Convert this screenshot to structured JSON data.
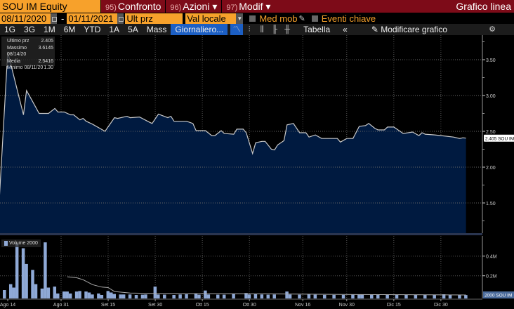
{
  "header": {
    "ticker": "SOU IM Equity",
    "compare": {
      "num": "95)",
      "label": "Confronto"
    },
    "actions": {
      "num": "96)",
      "label": "Azioni ▾"
    },
    "modify": {
      "num": "97)",
      "label": "Modif ▾"
    },
    "chart_type": "Grafico linea"
  },
  "controls": {
    "start_date": "08/11/2020",
    "separator": "-",
    "end_date": "01/11/2021",
    "field": "Ult prz",
    "currency": "Val locale",
    "moving_avg": "Med mob",
    "key_events": "Eventi chiave"
  },
  "toolbar": {
    "ranges": [
      "1G",
      "3G",
      "1M",
      "6M",
      "YTD",
      "1A",
      "5A",
      "Mass"
    ],
    "period": "Giornaliero...",
    "table": "Tabella",
    "collapse": "«",
    "edit": "Modificare grafico"
  },
  "legend": {
    "last_label": "Ultimo prz",
    "last_value": "2.405",
    "high_label": "Massimo 08/14/20",
    "high_value": "3.6145",
    "avg_label": "Media",
    "avg_value": "2.5416",
    "low_label": "Minimo 08/11/20",
    "low_value": "1.30"
  },
  "volume_legend": "Volume 2000",
  "colors": {
    "orange": "#f7a12b",
    "header_red": "#7d0b18",
    "area": "#001a40",
    "line": "#c8c8c8",
    "volume": "#8fa9d6",
    "active": "#1c5fc4"
  },
  "chart_data": {
    "type": "area",
    "x_unit": "days since 08/11/2020",
    "price": {
      "ylim": [
        1.1,
        3.8
      ],
      "ticks": [
        "3.50",
        "3.00",
        "2.50",
        "2.00",
        "1.50"
      ],
      "tick_values": [
        3.5,
        3.0,
        2.5,
        2.0,
        1.5
      ],
      "last_tag": "2.405 SOU IM",
      "points": [
        [
          0,
          1.3
        ],
        [
          3,
          3.61
        ],
        [
          8,
          2.73
        ],
        [
          9,
          3.07
        ],
        [
          11,
          2.91
        ],
        [
          13,
          2.75
        ],
        [
          16,
          2.75
        ],
        [
          18,
          2.82
        ],
        [
          19,
          2.77
        ],
        [
          21,
          2.77
        ],
        [
          23,
          2.73
        ],
        [
          24,
          2.73
        ],
        [
          26,
          2.66
        ],
        [
          27,
          2.68
        ],
        [
          28,
          2.64
        ],
        [
          30,
          2.6
        ],
        [
          34,
          2.5
        ],
        [
          37,
          2.69
        ],
        [
          38,
          2.68
        ],
        [
          41,
          2.71
        ],
        [
          42,
          2.69
        ],
        [
          45,
          2.7
        ],
        [
          48,
          2.63
        ],
        [
          49,
          2.61
        ],
        [
          51,
          2.74
        ],
        [
          54,
          2.69
        ],
        [
          55,
          2.71
        ],
        [
          56,
          2.64
        ],
        [
          60,
          2.64
        ],
        [
          62,
          2.61
        ],
        [
          63,
          2.51
        ],
        [
          66,
          2.51
        ],
        [
          68,
          2.44
        ],
        [
          69,
          2.44
        ],
        [
          71,
          2.51
        ],
        [
          72,
          2.47
        ],
        [
          75,
          2.46
        ],
        [
          76,
          2.53
        ],
        [
          78,
          2.53
        ],
        [
          79,
          2.48
        ],
        [
          81,
          2.19
        ],
        [
          82,
          2.34
        ],
        [
          84,
          2.36
        ],
        [
          85,
          2.36
        ],
        [
          87,
          2.25
        ],
        [
          88,
          2.24
        ],
        [
          89,
          2.31
        ],
        [
          91,
          2.37
        ],
        [
          92,
          2.59
        ],
        [
          94,
          2.61
        ],
        [
          96,
          2.48
        ],
        [
          98,
          2.48
        ],
        [
          99,
          2.42
        ],
        [
          101,
          2.45
        ],
        [
          103,
          2.4
        ],
        [
          108,
          2.4
        ],
        [
          109,
          2.35
        ],
        [
          111,
          2.4
        ],
        [
          113,
          2.4
        ],
        [
          115,
          2.57
        ],
        [
          117,
          2.58
        ],
        [
          118,
          2.61
        ],
        [
          120,
          2.54
        ],
        [
          121,
          2.52
        ],
        [
          123,
          2.52
        ],
        [
          124,
          2.56
        ],
        [
          126,
          2.56
        ],
        [
          128,
          2.5
        ],
        [
          129,
          2.47
        ],
        [
          132,
          2.49
        ],
        [
          134,
          2.44
        ],
        [
          135,
          2.48
        ],
        [
          136,
          2.46
        ],
        [
          139,
          2.45
        ],
        [
          141,
          2.44
        ],
        [
          143,
          2.43
        ],
        [
          145,
          2.42
        ],
        [
          147,
          2.4
        ],
        [
          148,
          2.41
        ],
        [
          149,
          2.405
        ]
      ]
    },
    "volume": {
      "ylim": [
        0,
        0.6
      ],
      "ticks": [
        "0.4M",
        "0.2M"
      ],
      "tick_values": [
        0.4,
        0.2
      ],
      "last_tag": "2000 SOU IM",
      "bars": [
        [
          2,
          0.055
        ],
        [
          4,
          0.115
        ],
        [
          5,
          0.08
        ],
        [
          6,
          0.53
        ],
        [
          8,
          0.48
        ],
        [
          9,
          0.32
        ],
        [
          11,
          0.26
        ],
        [
          12,
          0.115
        ],
        [
          14,
          0.07
        ],
        [
          15,
          0.54
        ],
        [
          16,
          0.08
        ],
        [
          18,
          0.09
        ],
        [
          19,
          0.02
        ],
        [
          21,
          0.04
        ],
        [
          22,
          0.04
        ],
        [
          23,
          0.02
        ],
        [
          25,
          0.04
        ],
        [
          26,
          0.045
        ],
        [
          28,
          0.04
        ],
        [
          29,
          0.03
        ],
        [
          30,
          0.01
        ],
        [
          32,
          0.02
        ],
        [
          33,
          0.005
        ],
        [
          35,
          0.045
        ],
        [
          36,
          0.03
        ],
        [
          37,
          0.015
        ],
        [
          39,
          0.01
        ],
        [
          40,
          0.01
        ],
        [
          42,
          0.01
        ],
        [
          44,
          0.005
        ],
        [
          46,
          0.008
        ],
        [
          47,
          0.01
        ],
        [
          50,
          0.09
        ],
        [
          51,
          0.01
        ],
        [
          53,
          0.008
        ],
        [
          56,
          0.005
        ],
        [
          58,
          0.01
        ],
        [
          60,
          0.012
        ],
        [
          63,
          0.02
        ],
        [
          64,
          0.008
        ],
        [
          66,
          0.05
        ],
        [
          67,
          0.01
        ],
        [
          70,
          0.008
        ],
        [
          72,
          0.008
        ],
        [
          75,
          0.015
        ],
        [
          79,
          0.025
        ],
        [
          80,
          0.01
        ],
        [
          82,
          0.012
        ],
        [
          84,
          0.01
        ],
        [
          86,
          0.008
        ],
        [
          88,
          0.01
        ],
        [
          92,
          0.04
        ],
        [
          93,
          0.01
        ],
        [
          96,
          0.008
        ],
        [
          99,
          0.012
        ],
        [
          101,
          0.008
        ],
        [
          104,
          0.006
        ],
        [
          107,
          0.006
        ],
        [
          110,
          0.006
        ],
        [
          113,
          0.008
        ],
        [
          115,
          0.01
        ],
        [
          116,
          0.01
        ],
        [
          119,
          0.012
        ],
        [
          121,
          0.006
        ],
        [
          124,
          0.006
        ],
        [
          127,
          0.006
        ],
        [
          130,
          0.006
        ],
        [
          133,
          0.005
        ],
        [
          136,
          0.005
        ],
        [
          139,
          0.005
        ],
        [
          142,
          0.012
        ],
        [
          144,
          0.005
        ],
        [
          147,
          0.004
        ],
        [
          149,
          0.004
        ]
      ],
      "moving_average": [
        [
          22,
          0.19
        ],
        [
          25,
          0.18
        ],
        [
          27,
          0.16
        ],
        [
          30,
          0.11
        ],
        [
          33,
          0.085
        ],
        [
          35,
          0.08
        ],
        [
          37,
          0.04
        ],
        [
          42,
          0.025
        ],
        [
          50,
          0.02
        ],
        [
          70,
          0.018
        ],
        [
          90,
          0.015
        ],
        [
          110,
          0.01
        ],
        [
          130,
          0.008
        ],
        [
          149,
          0.005
        ]
      ]
    },
    "x_ticks": [
      {
        "label": "Ago 14",
        "day": 3
      },
      {
        "label": "Ago 31",
        "day": 20
      },
      {
        "label": "Set 15",
        "day": 35
      },
      {
        "label": "Set 30",
        "day": 50
      },
      {
        "label": "Ott 15",
        "day": 65
      },
      {
        "label": "Ott 30",
        "day": 80
      },
      {
        "label": "Nov 16",
        "day": 97
      },
      {
        "label": "Nov 30",
        "day": 111
      },
      {
        "label": "Dic 15",
        "day": 126
      },
      {
        "label": "Dic 30",
        "day": 141
      }
    ]
  }
}
